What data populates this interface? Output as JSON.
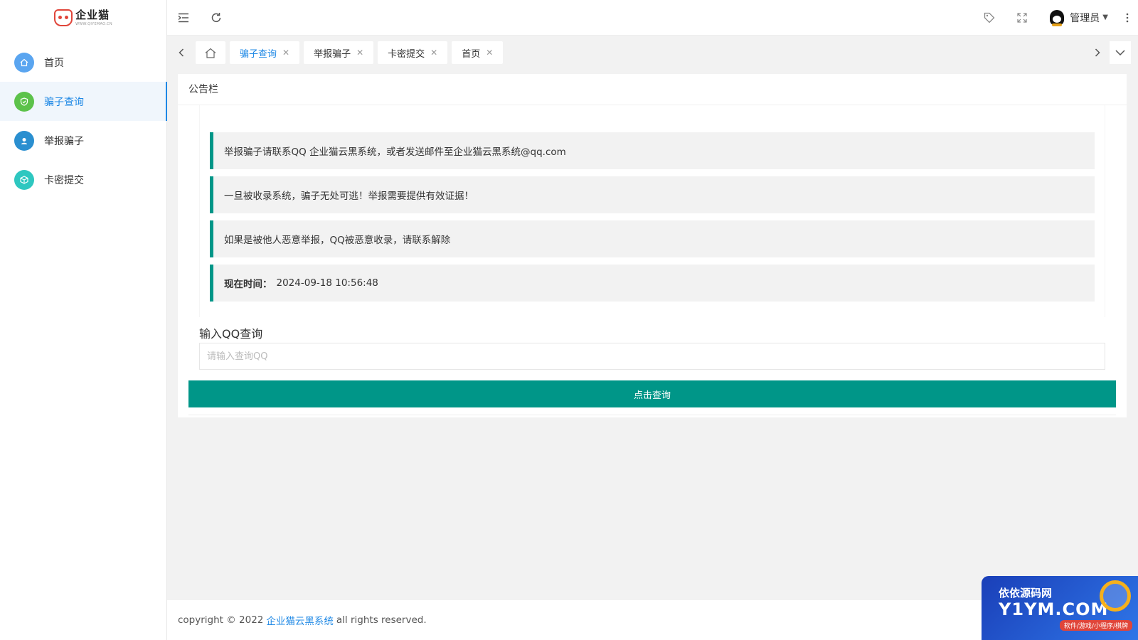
{
  "app": {
    "logo_text": "企业猫",
    "logo_sub": "WWW.QIYEMAO.CN"
  },
  "sidebar": {
    "items": [
      {
        "label": "首页",
        "icon": "home-icon",
        "color": "#5aa5f0",
        "active": false
      },
      {
        "label": "骗子查询",
        "icon": "shield-check-icon",
        "color": "#5cc24a",
        "active": true
      },
      {
        "label": "举报骗子",
        "icon": "user-icon",
        "color": "#2a8fd0",
        "active": false
      },
      {
        "label": "卡密提交",
        "icon": "box-icon",
        "color": "#2ec7c0",
        "active": false
      }
    ]
  },
  "header": {
    "user_name": "管理员"
  },
  "tabs": [
    {
      "label": "骗子查询",
      "active": true
    },
    {
      "label": "举报骗子",
      "active": false
    },
    {
      "label": "卡密提交",
      "active": false
    },
    {
      "label": "首页",
      "active": false
    }
  ],
  "card": {
    "title": "公告栏",
    "notices": [
      "举报骗子请联系QQ 企业猫云黑系统，或者发送邮件至企业猫云黑系统@qq.com",
      "一旦被收录系统，骗子无处可逃！举报需要提供有效证据！",
      "如果是被他人恶意举报，QQ被恶意收录，请联系解除"
    ],
    "time_label": "现在时间：",
    "time_value": "2024-09-18 10:56:48",
    "query_label": "输入QQ查询",
    "query_placeholder": "请输入查询QQ",
    "query_value": "",
    "button_label": "点击查询"
  },
  "footer": {
    "prefix": "copyright © 2022",
    "link": "企业猫云黑系统",
    "suffix": "all rights reserved."
  },
  "watermark": {
    "top": "依依源码网",
    "main": "Y1YM.COM",
    "sub": "软件/游戏/小程序/棋牌"
  },
  "colors": {
    "accent": "#009688",
    "link": "#1e88e5"
  }
}
